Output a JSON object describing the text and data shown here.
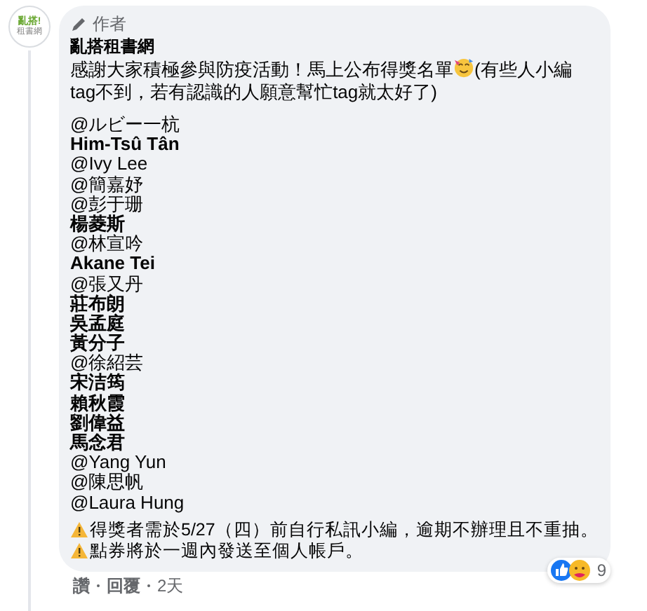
{
  "comment": {
    "badge": "作者",
    "author": "亂搭租書網",
    "text_before_emoji": "感謝大家積極參與防疫活動！馬上公布得獎名單",
    "text_after_emoji": "(有些人小編tag不到，若有認識的人願意幫忙tag就太好了)",
    "mentions": [
      {
        "name": "@ルビー一杭",
        "tagged": false
      },
      {
        "name": "Him-Tsû Tân",
        "tagged": true
      },
      {
        "name": "@Ivy Lee",
        "tagged": false
      },
      {
        "name": "@簡嘉妤",
        "tagged": false
      },
      {
        "name": "@彭于珊",
        "tagged": false
      },
      {
        "name": "楊菱斯",
        "tagged": true
      },
      {
        "name": "@林宣吟",
        "tagged": false
      },
      {
        "name": "Akane Tei",
        "tagged": true
      },
      {
        "name": "@張又丹",
        "tagged": false
      },
      {
        "name": "莊布朗",
        "tagged": true
      },
      {
        "name": "吳孟庭",
        "tagged": true
      },
      {
        "name": "黃分子",
        "tagged": true
      },
      {
        "name": "@徐紹芸",
        "tagged": false
      },
      {
        "name": "宋洁筠",
        "tagged": true
      },
      {
        "name": "賴秋霞",
        "tagged": true
      },
      {
        "name": "劉偉益",
        "tagged": true
      },
      {
        "name": "馬念君",
        "tagged": true
      },
      {
        "name": "@Yang Yun",
        "tagged": false
      },
      {
        "name": "@陳思帆",
        "tagged": false
      },
      {
        "name": "@Laura Hung",
        "tagged": false
      }
    ],
    "notes": [
      "得獎者需於5/27（四）前自行私訊小編，逾期不辦理且不重抽。",
      "點券將於一週內發送至個人帳戶。"
    ],
    "reaction_count": "9",
    "actions": [
      "讚",
      "回覆"
    ],
    "time": "2天"
  },
  "avatar": {
    "line1": "亂搭!",
    "line2": "租書網"
  }
}
